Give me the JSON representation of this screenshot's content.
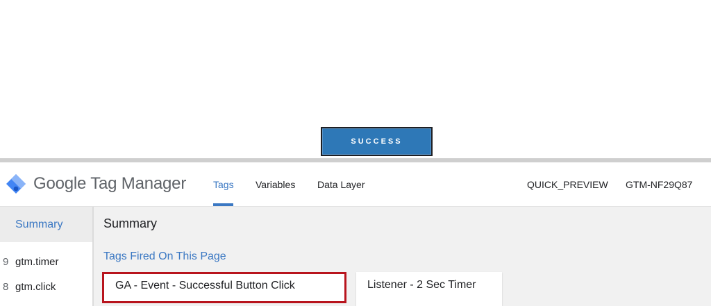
{
  "page": {
    "success_button": "SUCCESS"
  },
  "header": {
    "brand": "Google Tag Manager",
    "tabs": [
      {
        "label": "Tags",
        "active": true
      },
      {
        "label": "Variables",
        "active": false
      },
      {
        "label": "Data Layer",
        "active": false
      }
    ],
    "quick_preview": "QUICK_PREVIEW",
    "container_id": "GTM-NF29Q87"
  },
  "sidebar": {
    "summary_label": "Summary",
    "events": [
      {
        "number": "9",
        "label": "gtm.timer"
      },
      {
        "number": "8",
        "label": "gtm.click"
      }
    ]
  },
  "main": {
    "title": "Summary",
    "section_title": "Tags Fired On This Page",
    "tags": [
      {
        "label": "GA - Event - Successful Button Click",
        "highlighted": true
      },
      {
        "label": "Listener - 2 Sec Timer",
        "highlighted": false
      }
    ]
  },
  "colors": {
    "success_button_bg": "#2e78b7",
    "accent_blue": "#3b78c3",
    "highlight_red": "#b8141d",
    "logo_blue": "#4285f4"
  },
  "icons": {
    "logo": "gtm-diamond-logo-icon"
  }
}
